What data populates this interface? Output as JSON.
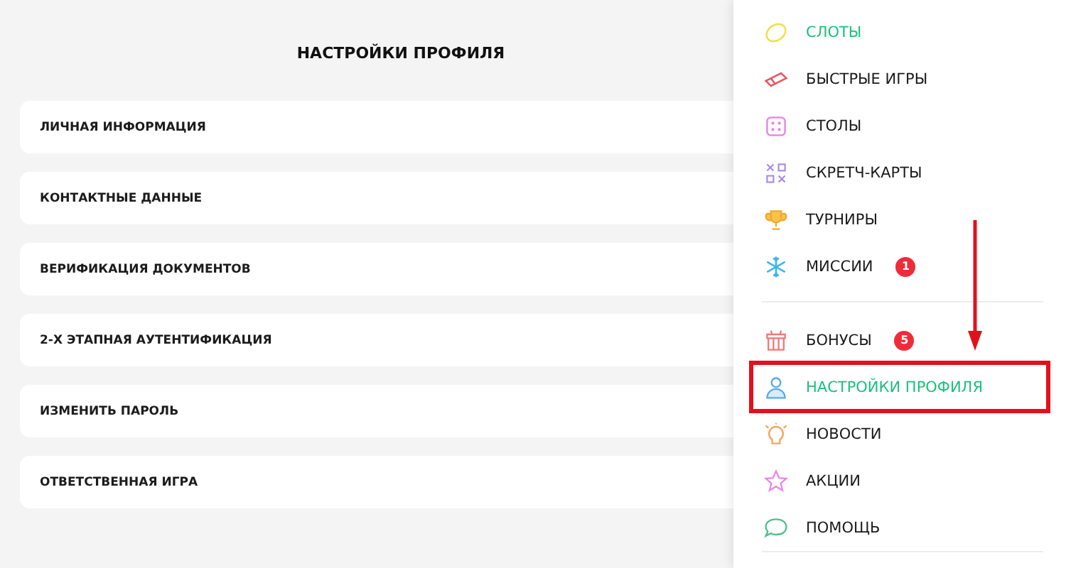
{
  "page": {
    "title": "НАСТРОЙКИ ПРОФИЛЯ"
  },
  "settings": [
    {
      "label": "ЛИЧНАЯ ИНФОРМАЦИЯ"
    },
    {
      "label": "КОНТАКТНЫЕ ДАННЫЕ"
    },
    {
      "label": "ВЕРИФИКАЦИЯ ДОКУМЕНТОВ"
    },
    {
      "label": "2-Х ЭТАПНАЯ АУТЕНТИФИКАЦИЯ"
    },
    {
      "label": "ИЗМЕНИТЬ ПАРОЛЬ"
    },
    {
      "label": "ОТВЕТСТВЕННАЯ ИГРА"
    }
  ],
  "menu": {
    "groups": [
      {
        "items": [
          {
            "label": "СЛОТЫ",
            "selected": true,
            "highlighted": false
          },
          {
            "label": "БЫСТРЫЕ ИГРЫ",
            "selected": false,
            "highlighted": false
          },
          {
            "label": "СТОЛЫ",
            "selected": false,
            "highlighted": false
          },
          {
            "label": "СКРЕТЧ-КАРТЫ",
            "selected": false,
            "highlighted": false
          },
          {
            "label": "ТУРНИРЫ",
            "selected": false,
            "highlighted": false
          },
          {
            "label": "МИССИИ",
            "selected": false,
            "highlighted": false,
            "badge": "1"
          }
        ]
      },
      {
        "items": [
          {
            "label": "БОНУСЫ",
            "selected": false,
            "highlighted": false,
            "badge": "5"
          },
          {
            "label": "НАСТРОЙКИ ПРОФИЛЯ",
            "selected": true,
            "highlighted": true
          },
          {
            "label": "НОВОСТИ",
            "selected": false,
            "highlighted": false
          },
          {
            "label": "АКЦИИ",
            "selected": false,
            "highlighted": false
          },
          {
            "label": "ПОМОЩЬ",
            "selected": false,
            "highlighted": false
          }
        ]
      }
    ]
  }
}
